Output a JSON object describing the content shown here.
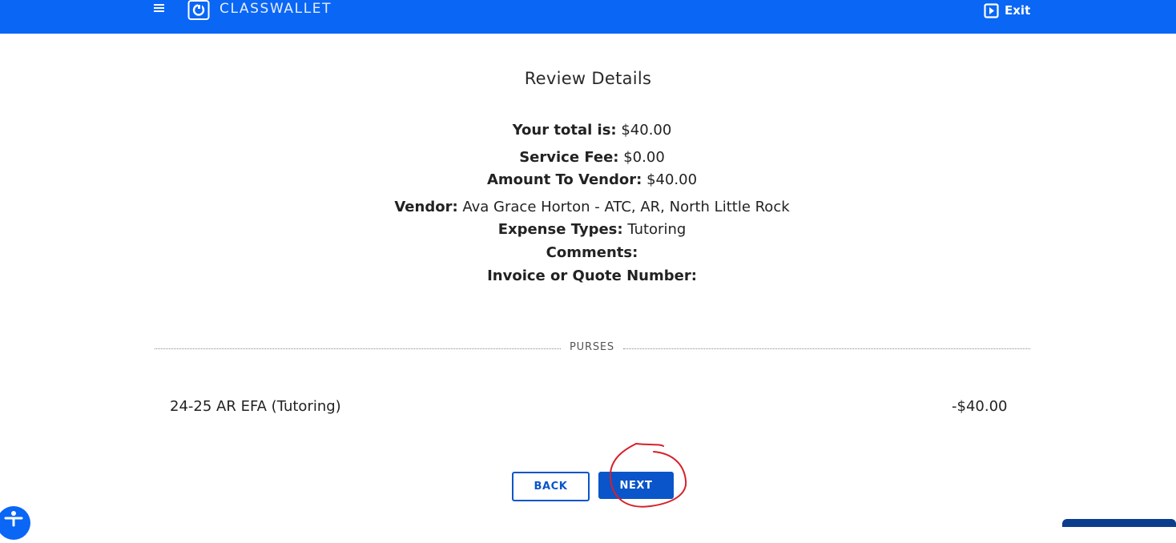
{
  "header": {
    "brand": "CLASSWALLET",
    "exit_label": "Exit",
    "accent_color": "#0a66f5"
  },
  "review": {
    "title": "Review Details",
    "total_label": "Your total is:",
    "total_value": "$40.00",
    "service_fee_label": "Service Fee:",
    "service_fee_value": "$0.00",
    "amount_to_vendor_label": "Amount To Vendor:",
    "amount_to_vendor_value": "$40.00",
    "vendor_label": "Vendor:",
    "vendor_value": "Ava Grace Horton - ATC, AR, North Little Rock",
    "expense_types_label": "Expense Types:",
    "expense_types_value": "Tutoring",
    "comments_label": "Comments:",
    "comments_value": "",
    "invoice_label": "Invoice or Quote Number:",
    "invoice_value": ""
  },
  "purses": {
    "section_label": "PURSES",
    "items": [
      {
        "name": "24-25 AR EFA (Tutoring)",
        "amount": "-$40.00"
      }
    ]
  },
  "actions": {
    "back_label": "BACK",
    "next_label": "NEXT",
    "button_color": "#0a55c9"
  },
  "icons": {
    "menu": "hamburger-menu-icon",
    "logo": "classwallet-logo-icon",
    "exit": "exit-door-icon",
    "accessibility": "accessibility-icon"
  }
}
